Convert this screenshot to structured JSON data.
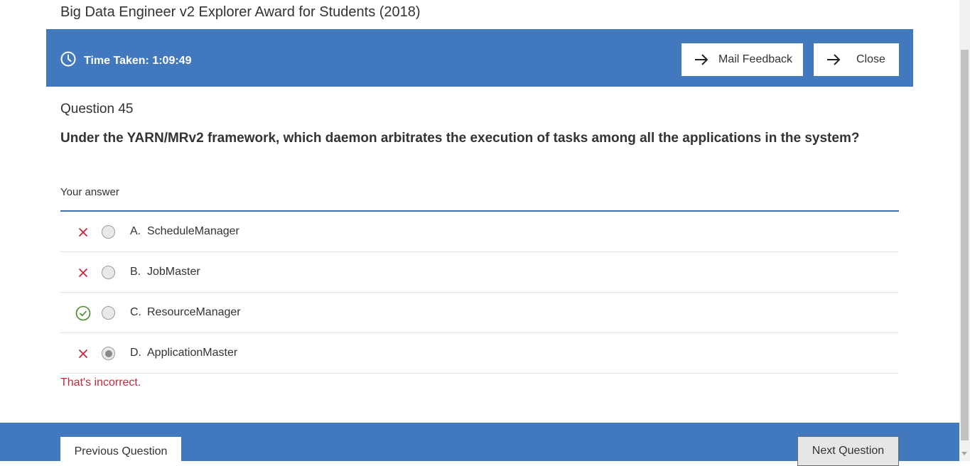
{
  "page": {
    "title": "Big Data Engineer v2 Explorer Award for Students (2018)"
  },
  "header": {
    "timer_label": "Time Taken: 1:09:49",
    "mail_feedback_label": "Mail Feedback",
    "close_label": "Close"
  },
  "question": {
    "number_label": "Question 45",
    "text": "Under the YARN/MRv2 framework, which daemon arbitrates the execution of tasks among all the applications in the system?",
    "your_answer_label": "Your answer"
  },
  "options": [
    {
      "letter": "A.",
      "text": "ScheduleManager",
      "status": "incorrect",
      "selected": false
    },
    {
      "letter": "B.",
      "text": "JobMaster",
      "status": "incorrect",
      "selected": false
    },
    {
      "letter": "C.",
      "text": "ResourceManager",
      "status": "correct",
      "selected": false
    },
    {
      "letter": "D.",
      "text": "ApplicationMaster",
      "status": "incorrect",
      "selected": true
    }
  ],
  "feedback": "That's incorrect.",
  "footer": {
    "previous_label": "Previous Question",
    "next_label": "Next Question"
  },
  "colors": {
    "accent_blue": "#4279be",
    "incorrect_red": "#c5283d",
    "correct_green": "#4a8a2a"
  },
  "icons": {
    "timer": "clock-icon",
    "button_arrow": "arrow-right-icon",
    "incorrect": "x-mark-icon",
    "correct": "check-circle-icon"
  }
}
